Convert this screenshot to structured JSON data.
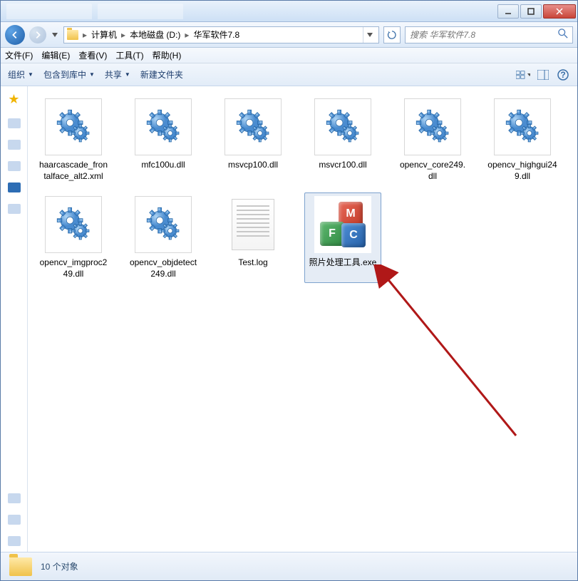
{
  "titlebar": {
    "minimize": "−",
    "maximize": "☐",
    "close": "✕"
  },
  "breadcrumb": {
    "items": [
      "计算机",
      "本地磁盘 (D:)",
      "华军软件7.8"
    ]
  },
  "search": {
    "placeholder": "搜索 华军软件7.8"
  },
  "menubar": {
    "file": "文件(F)",
    "edit": "编辑(E)",
    "view": "查看(V)",
    "tools": "工具(T)",
    "help": "帮助(H)"
  },
  "toolbar": {
    "organize": "组织",
    "include": "包含到库中",
    "share": "共享",
    "newfolder": "新建文件夹"
  },
  "files": [
    {
      "name": "haarcascade_frontalface_alt2.xml",
      "type": "gear",
      "selected": false
    },
    {
      "name": "mfc100u.dll",
      "type": "gear",
      "selected": false
    },
    {
      "name": "msvcp100.dll",
      "type": "gear",
      "selected": false
    },
    {
      "name": "msvcr100.dll",
      "type": "gear",
      "selected": false
    },
    {
      "name": "opencv_core249.dll",
      "type": "gear",
      "selected": false
    },
    {
      "name": "opencv_highgui249.dll",
      "type": "gear",
      "selected": false
    },
    {
      "name": "opencv_imgproc249.dll",
      "type": "gear",
      "selected": false
    },
    {
      "name": "opencv_objdetect249.dll",
      "type": "gear",
      "selected": false
    },
    {
      "name": "Test.log",
      "type": "text",
      "selected": false
    },
    {
      "name": "照片处理工具.exe",
      "type": "mfc",
      "selected": true
    }
  ],
  "status": {
    "text": "10 个对象"
  }
}
